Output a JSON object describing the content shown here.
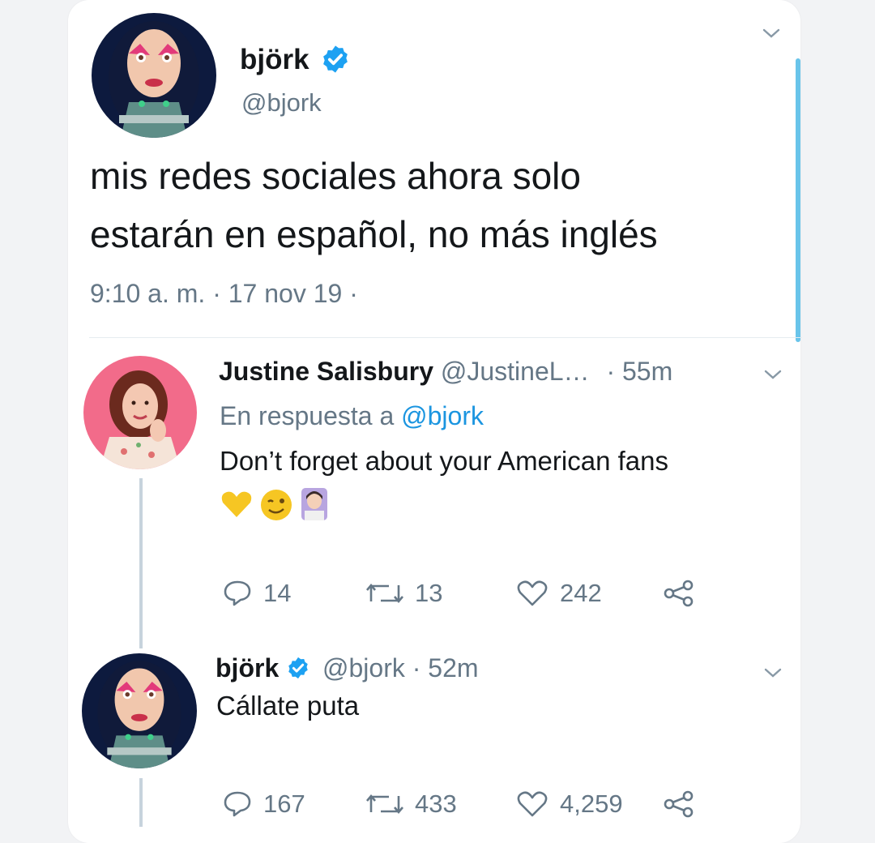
{
  "main_tweet": {
    "display_name": "björk",
    "handle": "@bjork",
    "text_line1": "mis redes sociales ahora solo",
    "text_line2": "estarán en español, no más inglés",
    "timestamp": "9:10 a. m. · 17 nov 19 ·"
  },
  "reply1": {
    "display_name": "Justine Salisbury",
    "handle": "@JustineL…",
    "time": "· 55m",
    "reply_to_prefix": "En respuesta a",
    "reply_to_handle": "@bjork",
    "text": "Don’t forget about your American fans",
    "emojis": [
      "yellow-heart-icon",
      "winking-face-icon",
      "woman-raising-hand-icon"
    ],
    "replies": "14",
    "retweets": "13",
    "likes": "242"
  },
  "reply2": {
    "display_name": "björk",
    "handle": "@bjork",
    "time": "· 52m",
    "text": "Cállate puta",
    "replies": "167",
    "retweets": "433",
    "likes": "4,259"
  },
  "colors": {
    "verified": "#1da1f2",
    "link": "#1b95e0",
    "muted": "#657786",
    "scrollbar": "#69c4ea"
  }
}
